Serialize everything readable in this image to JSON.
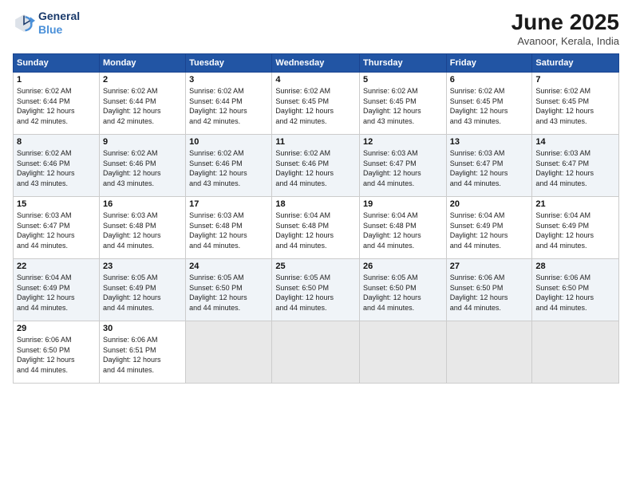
{
  "header": {
    "logo_line1": "General",
    "logo_line2": "Blue",
    "month": "June 2025",
    "location": "Avanoor, Kerala, India"
  },
  "days_of_week": [
    "Sunday",
    "Monday",
    "Tuesday",
    "Wednesday",
    "Thursday",
    "Friday",
    "Saturday"
  ],
  "weeks": [
    [
      {
        "day": "1",
        "info": "Sunrise: 6:02 AM\nSunset: 6:44 PM\nDaylight: 12 hours\nand 42 minutes."
      },
      {
        "day": "2",
        "info": "Sunrise: 6:02 AM\nSunset: 6:44 PM\nDaylight: 12 hours\nand 42 minutes."
      },
      {
        "day": "3",
        "info": "Sunrise: 6:02 AM\nSunset: 6:44 PM\nDaylight: 12 hours\nand 42 minutes."
      },
      {
        "day": "4",
        "info": "Sunrise: 6:02 AM\nSunset: 6:45 PM\nDaylight: 12 hours\nand 42 minutes."
      },
      {
        "day": "5",
        "info": "Sunrise: 6:02 AM\nSunset: 6:45 PM\nDaylight: 12 hours\nand 43 minutes."
      },
      {
        "day": "6",
        "info": "Sunrise: 6:02 AM\nSunset: 6:45 PM\nDaylight: 12 hours\nand 43 minutes."
      },
      {
        "day": "7",
        "info": "Sunrise: 6:02 AM\nSunset: 6:45 PM\nDaylight: 12 hours\nand 43 minutes."
      }
    ],
    [
      {
        "day": "8",
        "info": "Sunrise: 6:02 AM\nSunset: 6:46 PM\nDaylight: 12 hours\nand 43 minutes."
      },
      {
        "day": "9",
        "info": "Sunrise: 6:02 AM\nSunset: 6:46 PM\nDaylight: 12 hours\nand 43 minutes."
      },
      {
        "day": "10",
        "info": "Sunrise: 6:02 AM\nSunset: 6:46 PM\nDaylight: 12 hours\nand 43 minutes."
      },
      {
        "day": "11",
        "info": "Sunrise: 6:02 AM\nSunset: 6:46 PM\nDaylight: 12 hours\nand 44 minutes."
      },
      {
        "day": "12",
        "info": "Sunrise: 6:03 AM\nSunset: 6:47 PM\nDaylight: 12 hours\nand 44 minutes."
      },
      {
        "day": "13",
        "info": "Sunrise: 6:03 AM\nSunset: 6:47 PM\nDaylight: 12 hours\nand 44 minutes."
      },
      {
        "day": "14",
        "info": "Sunrise: 6:03 AM\nSunset: 6:47 PM\nDaylight: 12 hours\nand 44 minutes."
      }
    ],
    [
      {
        "day": "15",
        "info": "Sunrise: 6:03 AM\nSunset: 6:47 PM\nDaylight: 12 hours\nand 44 minutes."
      },
      {
        "day": "16",
        "info": "Sunrise: 6:03 AM\nSunset: 6:48 PM\nDaylight: 12 hours\nand 44 minutes."
      },
      {
        "day": "17",
        "info": "Sunrise: 6:03 AM\nSunset: 6:48 PM\nDaylight: 12 hours\nand 44 minutes."
      },
      {
        "day": "18",
        "info": "Sunrise: 6:04 AM\nSunset: 6:48 PM\nDaylight: 12 hours\nand 44 minutes."
      },
      {
        "day": "19",
        "info": "Sunrise: 6:04 AM\nSunset: 6:48 PM\nDaylight: 12 hours\nand 44 minutes."
      },
      {
        "day": "20",
        "info": "Sunrise: 6:04 AM\nSunset: 6:49 PM\nDaylight: 12 hours\nand 44 minutes."
      },
      {
        "day": "21",
        "info": "Sunrise: 6:04 AM\nSunset: 6:49 PM\nDaylight: 12 hours\nand 44 minutes."
      }
    ],
    [
      {
        "day": "22",
        "info": "Sunrise: 6:04 AM\nSunset: 6:49 PM\nDaylight: 12 hours\nand 44 minutes."
      },
      {
        "day": "23",
        "info": "Sunrise: 6:05 AM\nSunset: 6:49 PM\nDaylight: 12 hours\nand 44 minutes."
      },
      {
        "day": "24",
        "info": "Sunrise: 6:05 AM\nSunset: 6:50 PM\nDaylight: 12 hours\nand 44 minutes."
      },
      {
        "day": "25",
        "info": "Sunrise: 6:05 AM\nSunset: 6:50 PM\nDaylight: 12 hours\nand 44 minutes."
      },
      {
        "day": "26",
        "info": "Sunrise: 6:05 AM\nSunset: 6:50 PM\nDaylight: 12 hours\nand 44 minutes."
      },
      {
        "day": "27",
        "info": "Sunrise: 6:06 AM\nSunset: 6:50 PM\nDaylight: 12 hours\nand 44 minutes."
      },
      {
        "day": "28",
        "info": "Sunrise: 6:06 AM\nSunset: 6:50 PM\nDaylight: 12 hours\nand 44 minutes."
      }
    ],
    [
      {
        "day": "29",
        "info": "Sunrise: 6:06 AM\nSunset: 6:50 PM\nDaylight: 12 hours\nand 44 minutes."
      },
      {
        "day": "30",
        "info": "Sunrise: 6:06 AM\nSunset: 6:51 PM\nDaylight: 12 hours\nand 44 minutes."
      },
      null,
      null,
      null,
      null,
      null
    ]
  ]
}
